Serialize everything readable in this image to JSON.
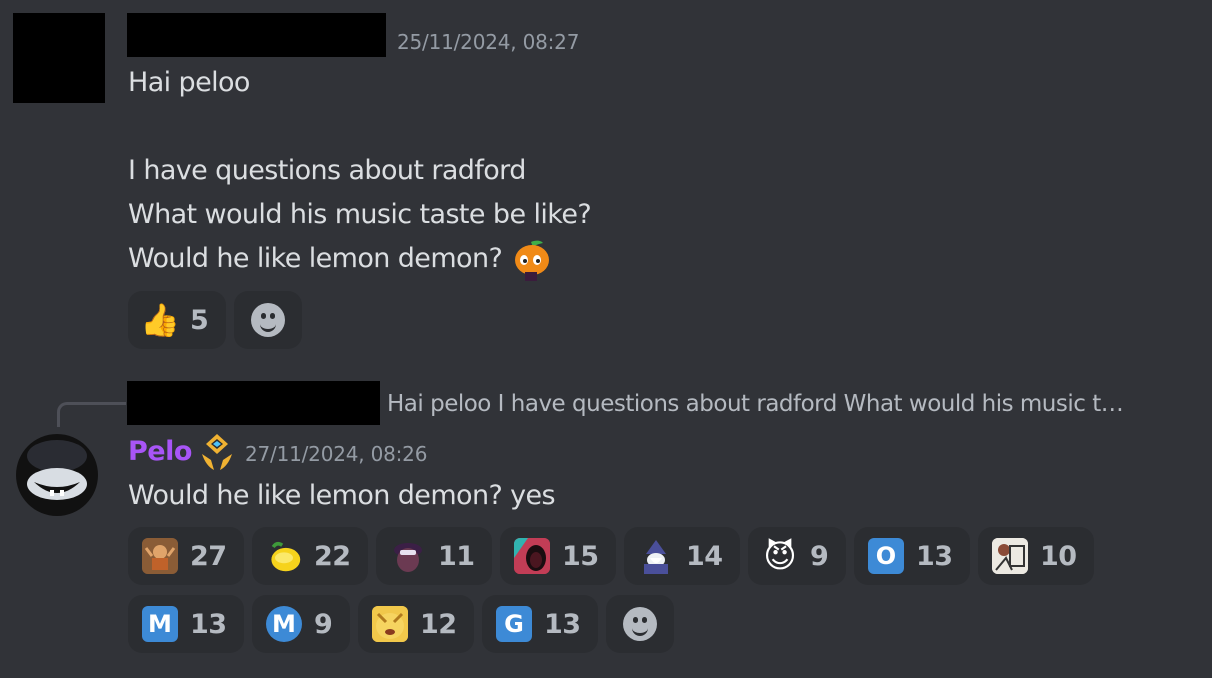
{
  "message1": {
    "timestamp": "25/11/2024, 08:27",
    "lines": [
      "Hai peloo",
      "",
      "I have questions about radford",
      "What would his music taste be like?",
      "Would he like lemon demon?"
    ],
    "inline_emoji": "pumpkin-emoji",
    "reactions": [
      {
        "icon": "thumbs-up-emoji",
        "count": "5"
      }
    ]
  },
  "reply": {
    "preview": "Hai peloo  I have questions about radford What would his music t…"
  },
  "message2": {
    "author": "Pelo",
    "author_color": "#a855f7",
    "badge": "role-badge-icon",
    "timestamp": "27/11/2024, 08:26",
    "text": "Would he like lemon demon? yes",
    "reactions": [
      {
        "icon": "dancing-character-emoji",
        "count": "27"
      },
      {
        "icon": "lemon-emoji",
        "count": "22"
      },
      {
        "icon": "purple-creature-emoji",
        "count": "11"
      },
      {
        "icon": "screaming-character-emoji",
        "count": "15"
      },
      {
        "icon": "wizard-emoji",
        "count": "14"
      },
      {
        "icon": "smiling-imp-emoji",
        "count": "9"
      },
      {
        "icon": "letter-o-emoji",
        "count": "13",
        "glyph": "O"
      },
      {
        "icon": "sketch-character-emoji",
        "count": "10"
      },
      {
        "icon": "letter-m-emoji",
        "count": "13",
        "glyph": "M"
      },
      {
        "icon": "letter-m-circle-emoji",
        "count": "9",
        "glyph": "M"
      },
      {
        "icon": "yellow-face-emoji",
        "count": "12"
      },
      {
        "icon": "letter-g-emoji",
        "count": "13",
        "glyph": "G"
      }
    ]
  },
  "colors": {
    "background": "#313338",
    "reaction_bg": "#2b2d31",
    "text": "#dbdee1",
    "muted": "#949ba4",
    "blue_tile": "#3d8ad6"
  }
}
